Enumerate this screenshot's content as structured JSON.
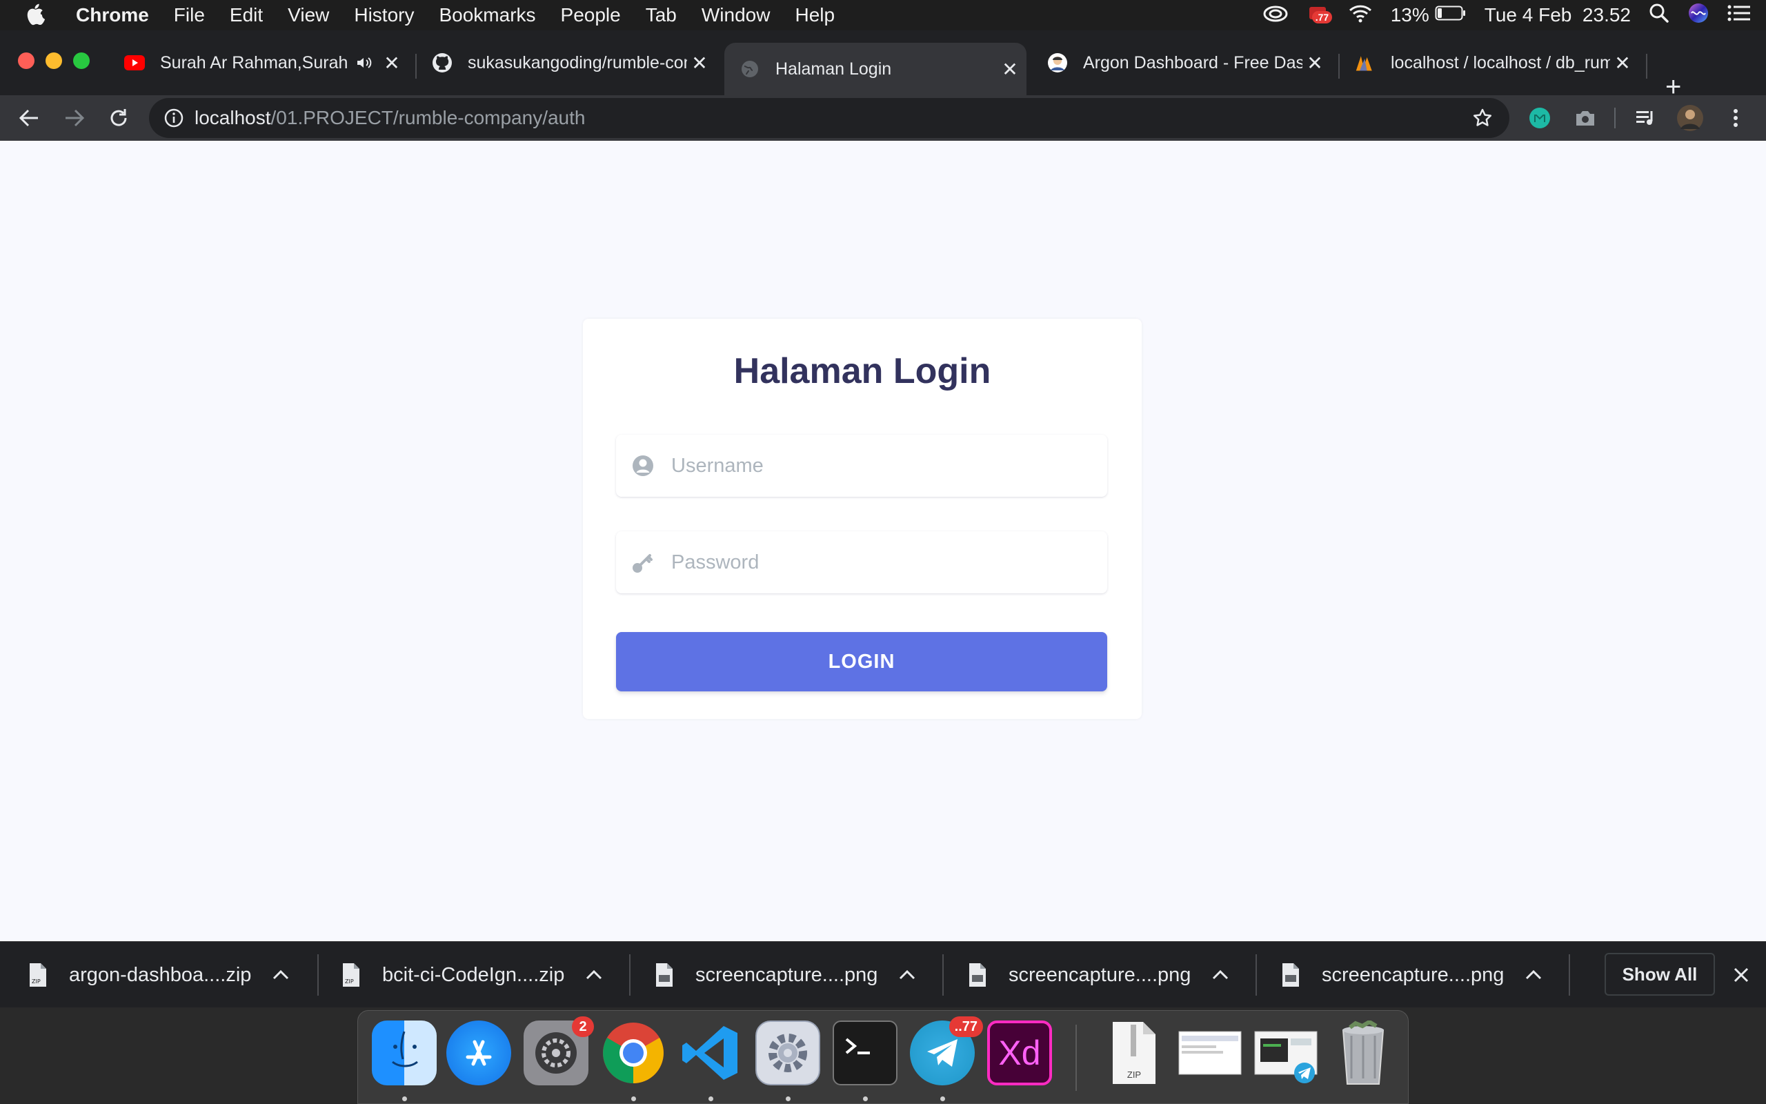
{
  "menubar": {
    "app_name": "Chrome",
    "menus": [
      "File",
      "Edit",
      "View",
      "History",
      "Bookmarks",
      "People",
      "Tab",
      "Window",
      "Help"
    ],
    "battery": "13%",
    "datetime": "Tue 4 Feb  23.52",
    "notif_badge": ".77"
  },
  "tabs": [
    {
      "title": "Surah Ar Rahman,Surah",
      "favicon": "youtube-icon"
    },
    {
      "title": "sukasukangoding/rumble-company",
      "favicon": "github-icon"
    },
    {
      "title": "Halaman Login",
      "favicon": "globe-icon"
    },
    {
      "title": "Argon Dashboard - Free Dashboard",
      "favicon": "avatar-icon"
    },
    {
      "title": "localhost / localhost / db_rumble",
      "favicon": "phpmyadmin-icon"
    }
  ],
  "address": {
    "host": "localhost",
    "path": "/01.PROJECT/rumble-company/auth"
  },
  "login": {
    "title": "Halaman Login",
    "username_placeholder": "Username",
    "password_placeholder": "Password",
    "button_label": "LOGIN"
  },
  "downloads": {
    "items": [
      {
        "name": "argon-dashboa....zip"
      },
      {
        "name": "bcit-ci-CodeIgn....zip"
      },
      {
        "name": "screencapture....png"
      },
      {
        "name": "screencapture....png"
      },
      {
        "name": "screencapture....png"
      }
    ],
    "show_all": "Show All"
  },
  "dock": {
    "prefs_badge": "2",
    "telegram_badge": "..77",
    "xd_label": "Xd",
    "zip_label": "ZIP"
  },
  "colors": {
    "primary": "#5e72e4",
    "heading": "#32325d",
    "page_bg": "#f8f9fe"
  }
}
